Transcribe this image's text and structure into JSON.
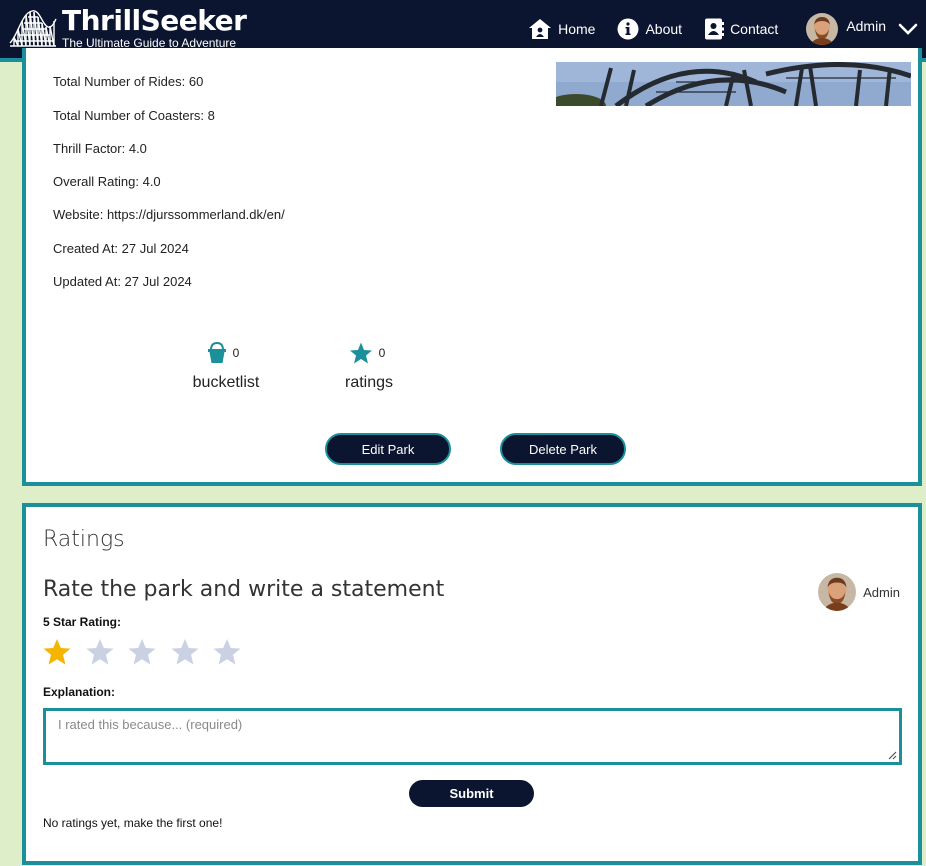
{
  "brand": {
    "title": "ThrillSeeker",
    "tagline": "The Ultimate Guide to Adventure"
  },
  "nav": {
    "links": [
      {
        "label": "Home",
        "icon": "home-icon"
      },
      {
        "label": "About",
        "icon": "info-icon"
      },
      {
        "label": "Contact",
        "icon": "contact-icon"
      }
    ],
    "user": {
      "label": "Admin",
      "icon": "chevron-down-icon"
    }
  },
  "park": {
    "info": [
      "Total Number of Rides: 60",
      "Total Number of Coasters: 8",
      "Thrill Factor: 4.0",
      "Overall Rating: 4.0",
      "Website: https://djurssommerland.dk/en/",
      "Created At: 27 Jul 2024",
      "Updated At: 27 Jul 2024"
    ],
    "stats": {
      "bucketlist": {
        "count": "0",
        "label": "bucketlist"
      },
      "ratings": {
        "count": "0",
        "label": "ratings"
      }
    },
    "buttons": {
      "edit": "Edit Park",
      "delete": "Delete Park"
    }
  },
  "ratings": {
    "title": "Ratings",
    "heading": "Rate the park and write a statement",
    "user": "Admin",
    "star_label": "5 Star Rating:",
    "selected_stars": 1,
    "total_stars": 5,
    "explanation_label": "Explanation:",
    "explanation_placeholder": "I rated this because... (required)",
    "explanation_value": "",
    "submit_label": "Submit",
    "empty_message": "No ratings yet, make the first one!"
  },
  "colors": {
    "navbar": "#0b1530",
    "accent": "#1b8f9a",
    "page_background": "#ddeec9",
    "star_active": "#f5b400",
    "star_inactive": "#c9d1e3"
  }
}
